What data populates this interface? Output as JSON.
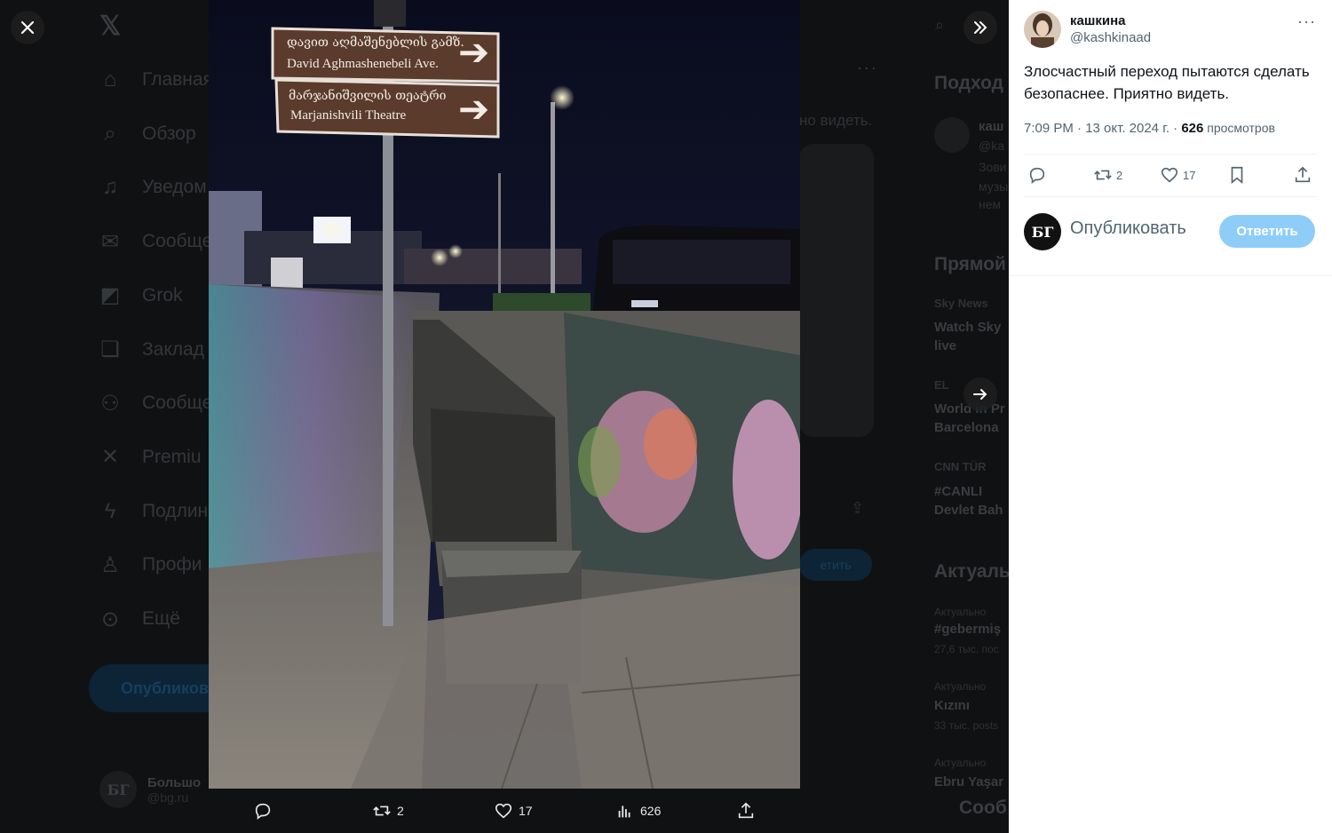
{
  "background": {
    "nav_items": [
      {
        "label": "Главная",
        "icon": "home-icon"
      },
      {
        "label": "Обзор",
        "icon": "search-icon"
      },
      {
        "label": "Уведом",
        "icon": "bell-icon"
      },
      {
        "label": "Сообще",
        "icon": "mail-icon"
      },
      {
        "label": "Grok",
        "icon": "grok-icon"
      },
      {
        "label": "Заклад",
        "icon": "bookmark-icon"
      },
      {
        "label": "Сообще",
        "icon": "communities-icon"
      },
      {
        "label": "Premiu",
        "icon": "x-logo-icon"
      },
      {
        "label": "Подлин",
        "icon": "bolt-icon"
      },
      {
        "label": "Профи",
        "icon": "person-icon"
      },
      {
        "label": "Ещё",
        "icon": "more-circle-icon"
      }
    ],
    "post_button": "Опубликов",
    "profile_name": "Большо",
    "profile_handle": "@bg.ru",
    "profile_avatar": "БГ",
    "mid_text": "но видеть.",
    "mid_button": "етить",
    "right_sections": {
      "who_to_follow": "Подход",
      "follow_name": "каш",
      "follow_handle": "@ka",
      "follow_bio": [
        "Зови",
        "музы",
        "нем"
      ],
      "live": "Прямой",
      "live1_src": "Sky News",
      "live1_title": [
        "Watch Sky",
        "live"
      ],
      "live2_src": "EL",
      "live2_title": [
        "World in Pr",
        "Barcelona"
      ],
      "live3_src": "CNN TÜR",
      "live3_title": [
        "#CANLI",
        "Devlet Bah"
      ],
      "trends": "Актуаль",
      "trend_rows": [
        {
          "cat": "Актуально",
          "name": "#gebermiş",
          "count": "27,6 тыс. пос"
        },
        {
          "cat": "Актуально",
          "name": "Kızını",
          "count": "33 тыс. posts"
        },
        {
          "cat": "Актуально",
          "name": "Ebru Yaşar",
          "count": ""
        }
      ],
      "messages": "Сооб"
    }
  },
  "photo": {
    "sign1_georgian": "დავით აღმაშენებლის გამზ.",
    "sign1_latin": "David Aghmashenebeli Ave.",
    "sign2_georgian": "მარჯანიშვილის თეატრი",
    "sign2_latin": "Marjanishvili Theatre"
  },
  "media_bar": {
    "retweets": "2",
    "likes": "17",
    "views": "626"
  },
  "tweet": {
    "author_name": "кашкина",
    "author_handle": "@kashkinaad",
    "text": "Злосчастный переход пытаются сделать безопаснее. Приятно видеть.",
    "time": "7:09 PM · 13 окт. 2024 г. · ",
    "views_count": "626",
    "views_label": " просмотров",
    "retweets": "2",
    "likes": "17"
  },
  "reply": {
    "avatar": "БГ",
    "placeholder": "Опубликовать",
    "button": "Ответить"
  },
  "colors": {
    "accent": "#1d9bf0",
    "reply_button_disabled": "#8ecdf7",
    "secondary_text": "#536471"
  }
}
